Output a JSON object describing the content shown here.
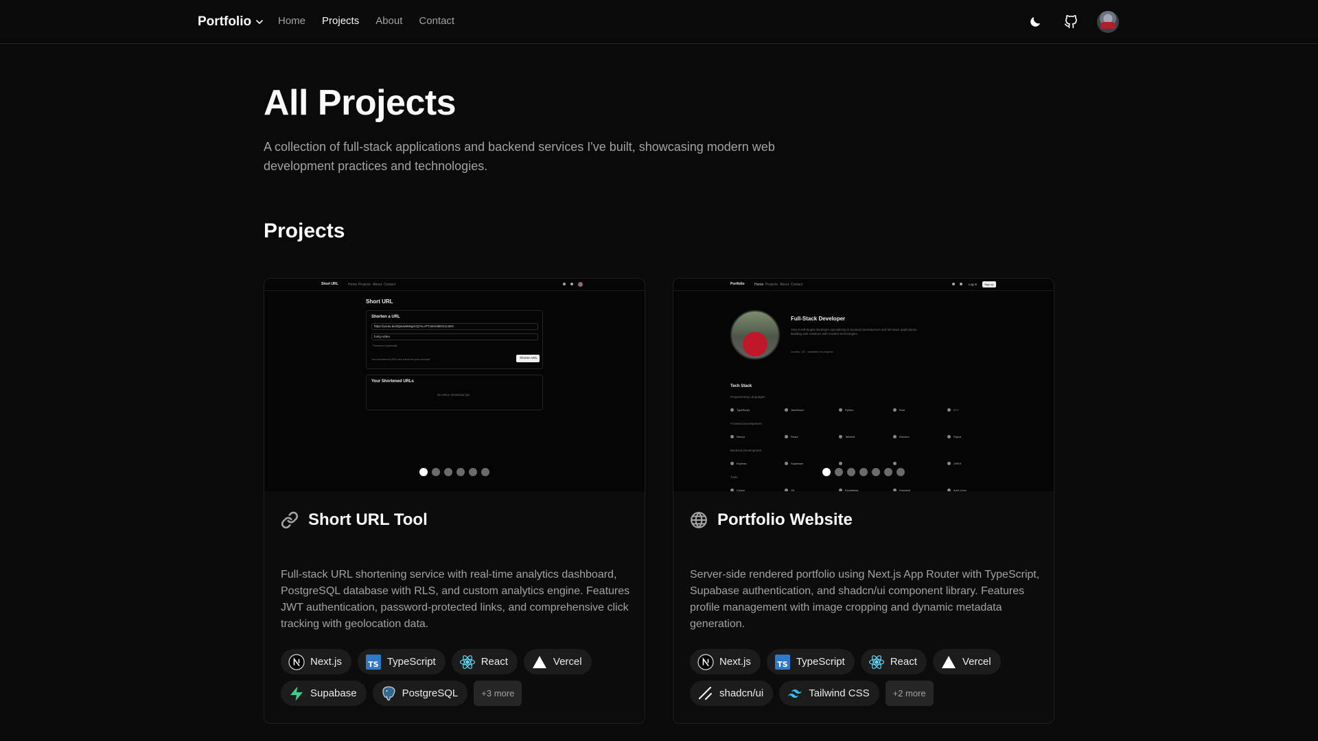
{
  "nav": {
    "brand": "Portfolio",
    "links": [
      "Home",
      "Projects",
      "About",
      "Contact"
    ],
    "active": "Projects"
  },
  "header": {
    "title": "All Projects",
    "description": "A collection of full-stack applications and backend services I've built, showcasing modern web development practices and technologies."
  },
  "section": {
    "title": "Projects"
  },
  "projects": [
    {
      "icon": "link-icon",
      "title": "Short URL Tool",
      "description": "Full-stack URL shortening service with real-time analytics dashboard, PostgreSQL database with RLS, and custom analytics engine. Features JWT authentication, password-protected links, and comprehensive click tracking with geolocation data.",
      "slides": 6,
      "active_slide": 1,
      "tags": [
        "Next.js",
        "TypeScript",
        "React",
        "Vercel",
        "Supabase",
        "PostgreSQL"
      ],
      "more": "+3 more",
      "preview": {
        "brand": "Short URL",
        "nav": [
          "Home",
          "Projects",
          "About",
          "Contact"
        ],
        "heading": "Short URL",
        "form_title": "Shorten a URL",
        "url_value": "https://youtu.be/dQw4w9WgXcQ?si=rPTx0iXOkE0z1c2E0",
        "alias_value": "funky-video",
        "password_hint": "Password (optional)",
        "save_note": "Your shortened URLs are saved to your account",
        "button": "Shorten URL",
        "list_title": "Your Shortened URLs",
        "empty": "No URLs shortened yet."
      }
    },
    {
      "icon": "globe-icon",
      "title": "Portfolio Website",
      "description": "Server-side rendered portfolio using Next.js App Router with TypeScript, Supabase authentication, and shadcn/ui component library. Features profile management with image cropping and dynamic metadata generation.",
      "slides": 7,
      "active_slide": 1,
      "tags": [
        "Next.js",
        "TypeScript",
        "React",
        "Vercel",
        "shadcn/ui",
        "Tailwind CSS"
      ],
      "more": "+2 more",
      "preview": {
        "brand": "Portfolio",
        "nav": [
          "Home",
          "Projects",
          "About",
          "Contact"
        ],
        "login": "Log in",
        "signup": "Sign up",
        "heading": "Full-Stack Developer",
        "bio": "Year 8 self-taught developer specializing in backend development and full-stack applications. Building web solutions with modern technologies.",
        "meta": "London, UK · Available for projects",
        "stack_title": "Tech Stack",
        "groups": [
          {
            "name": "Programming Languages",
            "items": [
              "TypeScript",
              "JavaScript",
              "Python",
              "Rust",
              "C++"
            ]
          },
          {
            "name": "Frontend Development",
            "items": [
              "Next.js",
              "React",
              "Tailwind",
              "Electron",
              "Figma"
            ]
          },
          {
            "name": "Backend Development",
            "items": [
              "Express",
              "Supabase",
              "",
              "",
              "JWKS"
            ]
          },
          {
            "name": "Tools",
            "items": [
              "Cursor",
              "Git",
              "Excalidraw",
              "Hyprland",
              "Arch Linux"
            ]
          }
        ]
      }
    }
  ],
  "tag_icons": {
    "Next.js": "nextjs-icon",
    "TypeScript": "typescript-icon",
    "React": "react-icon",
    "Vercel": "vercel-icon",
    "Supabase": "supabase-icon",
    "PostgreSQL": "postgresql-icon",
    "shadcn/ui": "shadcn-icon",
    "Tailwind CSS": "tailwind-icon"
  },
  "colors": {
    "background": "#0a0a0a",
    "foreground": "#fafafa",
    "muted": "#a3a3a3",
    "tag_bg": "#1c1c1c",
    "typescript": "#3178c6",
    "react": "#61dafb",
    "supabase": "#3ecf8e",
    "postgresql": "#336791",
    "tailwind": "#38bdf8"
  }
}
